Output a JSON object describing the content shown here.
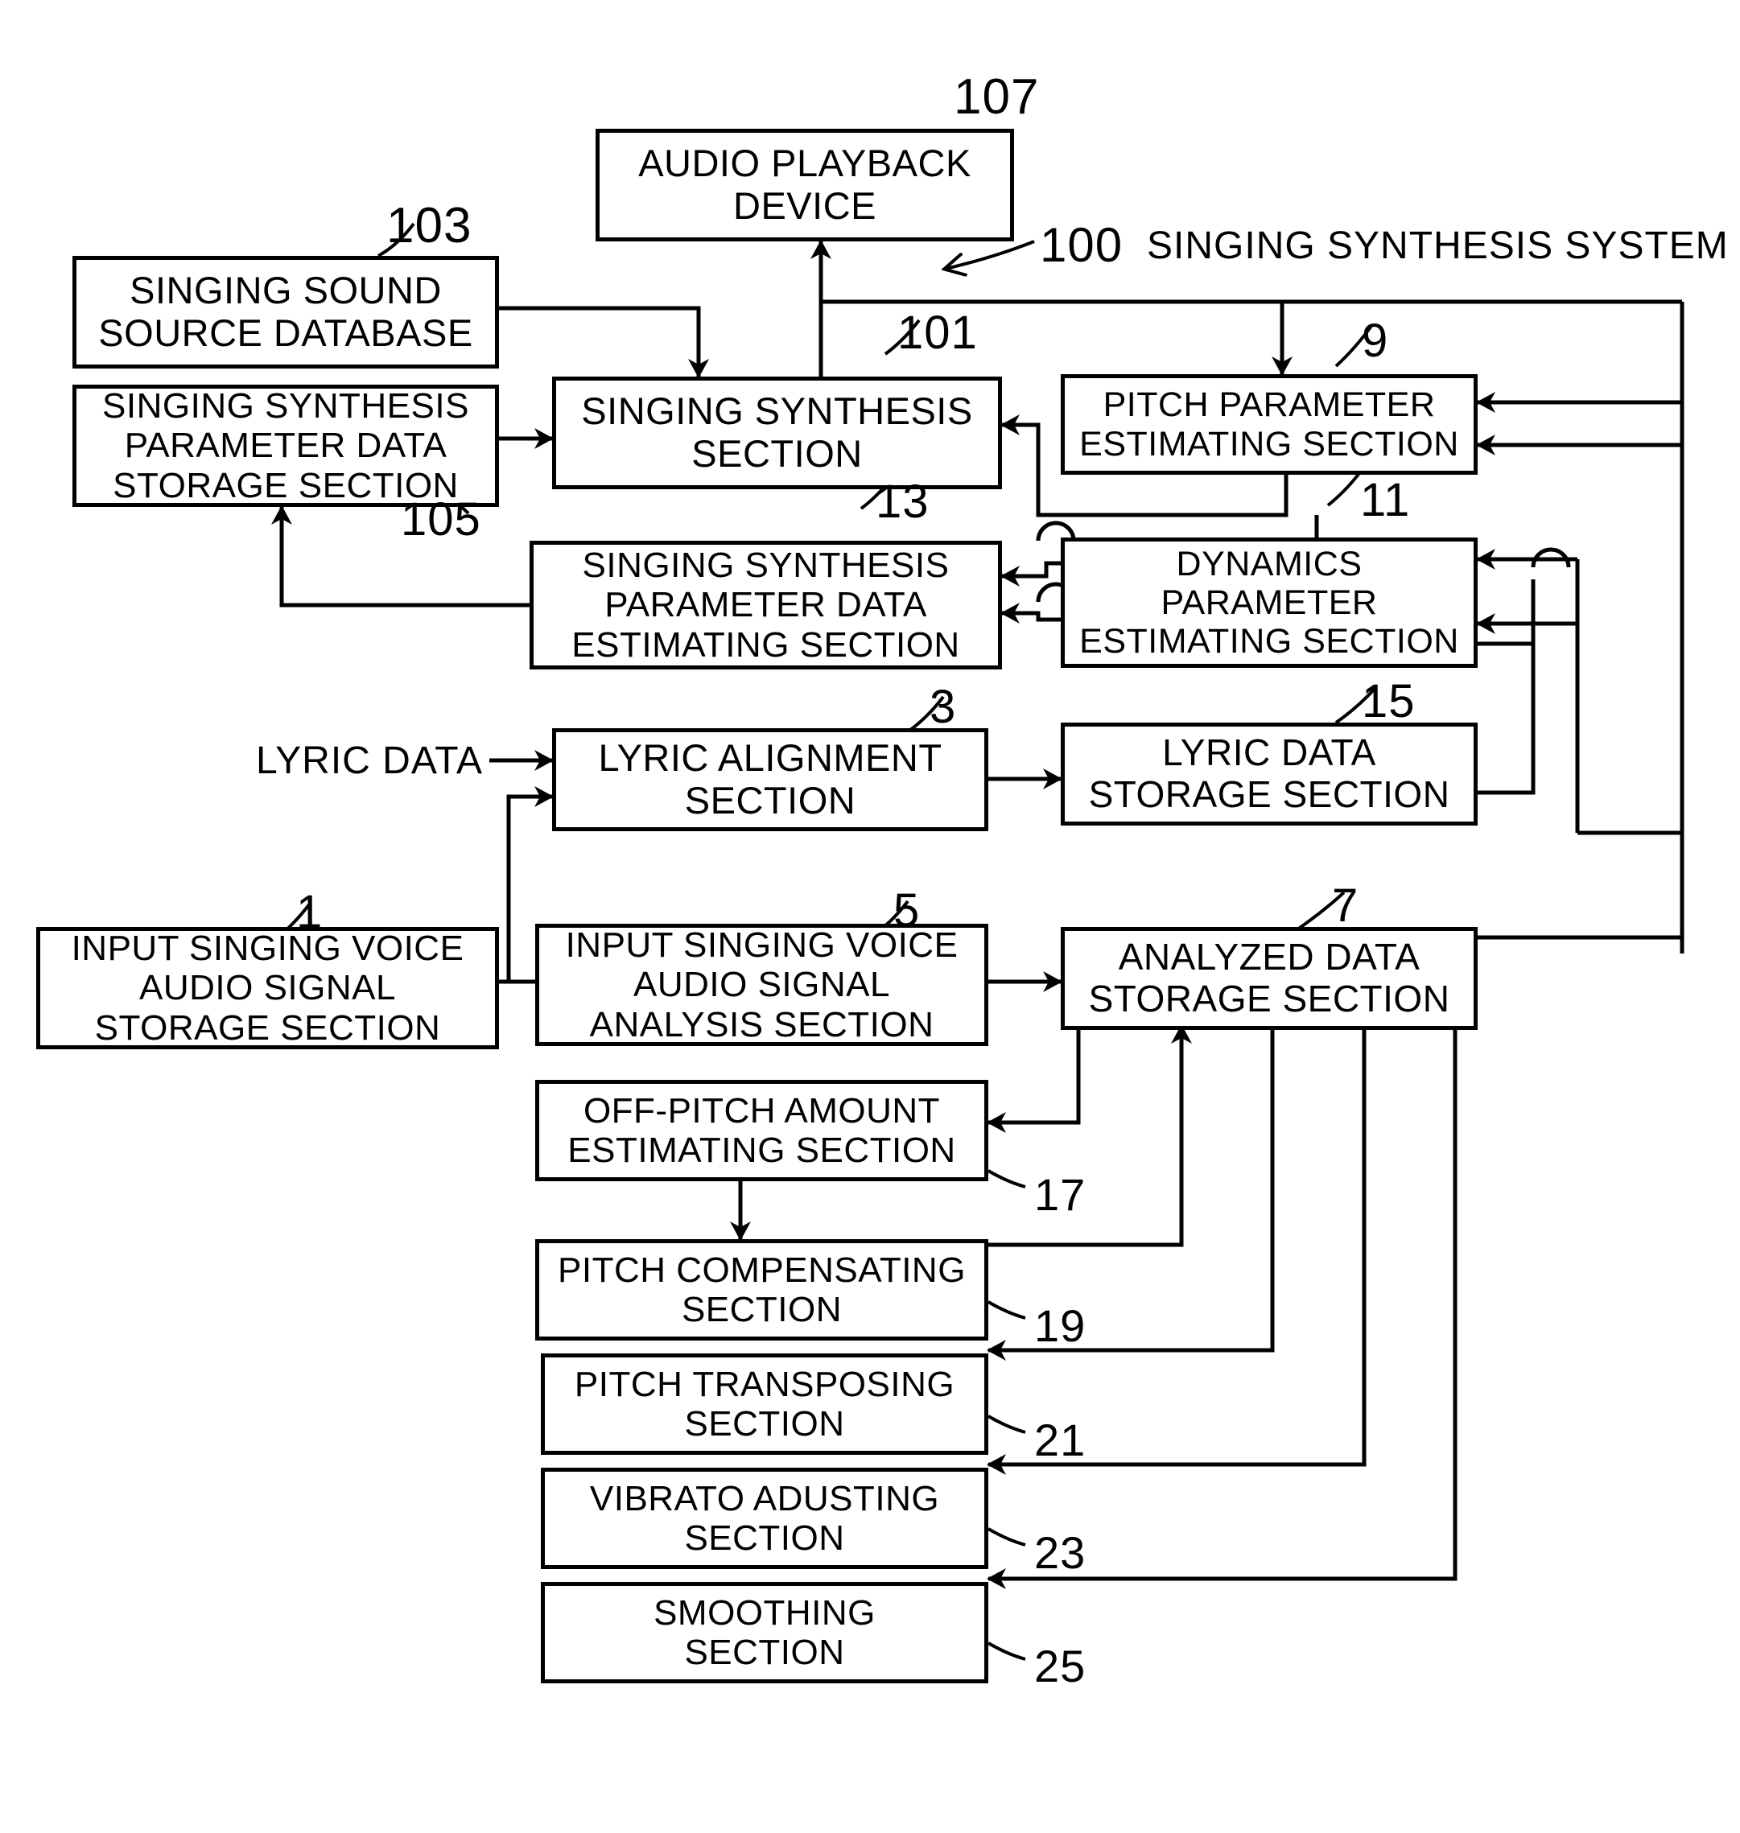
{
  "figure": {
    "system_label": "SINGING SYNTHESIS SYSTEM",
    "system_ref": "100",
    "external_input_label": "LYRIC DATA"
  },
  "boxes": [
    {
      "id": "audio_playback_device",
      "ref": "107",
      "lines": [
        "AUDIO PLAYBACK",
        "DEVICE"
      ]
    },
    {
      "id": "singing_sound_source_database",
      "ref": "103",
      "lines": [
        "SINGING SOUND",
        "SOURCE DATABASE"
      ]
    },
    {
      "id": "singing_synthesis_parameter_data_storage_section",
      "ref": "105",
      "lines": [
        "SINGING SYNTHESIS",
        "PARAMETER DATA",
        "STORAGE SECTION"
      ]
    },
    {
      "id": "singing_synthesis_section",
      "ref": "101",
      "lines": [
        "SINGING SYNTHESIS",
        "SECTION"
      ]
    },
    {
      "id": "pitch_parameter_estimating_section",
      "ref": "9",
      "lines": [
        "PITCH PARAMETER",
        "ESTIMATING SECTION"
      ]
    },
    {
      "id": "singing_synthesis_parameter_data_estimating_section",
      "ref": "13",
      "lines": [
        "SINGING SYNTHESIS",
        "PARAMETER DATA",
        "ESTIMATING SECTION"
      ]
    },
    {
      "id": "dynamics_parameter_estimating_section",
      "ref": "11",
      "lines": [
        "DYNAMICS",
        "PARAMETER",
        "ESTIMATING SECTION"
      ]
    },
    {
      "id": "lyric_alignment_section",
      "ref": "3",
      "lines": [
        "LYRIC ALIGNMENT",
        "SECTION"
      ]
    },
    {
      "id": "lyric_data_storage_section",
      "ref": "15",
      "lines": [
        "LYRIC DATA",
        "STORAGE SECTION"
      ]
    },
    {
      "id": "input_singing_voice_audio_signal_storage_section",
      "ref": "1",
      "lines": [
        "INPUT SINGING VOICE",
        "AUDIO SIGNAL",
        "STORAGE SECTION"
      ]
    },
    {
      "id": "input_singing_voice_audio_signal_analysis_section",
      "ref": "5",
      "lines": [
        "INPUT SINGING VOICE",
        "AUDIO SIGNAL",
        "ANALYSIS SECTION"
      ]
    },
    {
      "id": "analyzed_data_storage_section",
      "ref": "7",
      "lines": [
        "ANALYZED DATA",
        "STORAGE  SECTION"
      ]
    },
    {
      "id": "off_pitch_amount_estimating_section",
      "ref": "17",
      "lines": [
        "OFF-PITCH AMOUNT",
        "ESTIMATING SECTION"
      ]
    },
    {
      "id": "pitch_compensating_section",
      "ref": "19",
      "lines": [
        "PITCH COMPENSATING",
        "SECTION"
      ]
    },
    {
      "id": "pitch_transposing_section",
      "ref": "21",
      "lines": [
        "PITCH TRANSPOSING",
        "SECTION"
      ]
    },
    {
      "id": "vibrato_adusting_section",
      "ref": "23",
      "lines": [
        "VIBRATO ADUSTING",
        "SECTION"
      ]
    },
    {
      "id": "smoothing_section",
      "ref": "25",
      "lines": [
        "SMOOTHING",
        "SECTION"
      ]
    }
  ],
  "colors": {
    "stroke": "#000000",
    "background": "#ffffff"
  }
}
